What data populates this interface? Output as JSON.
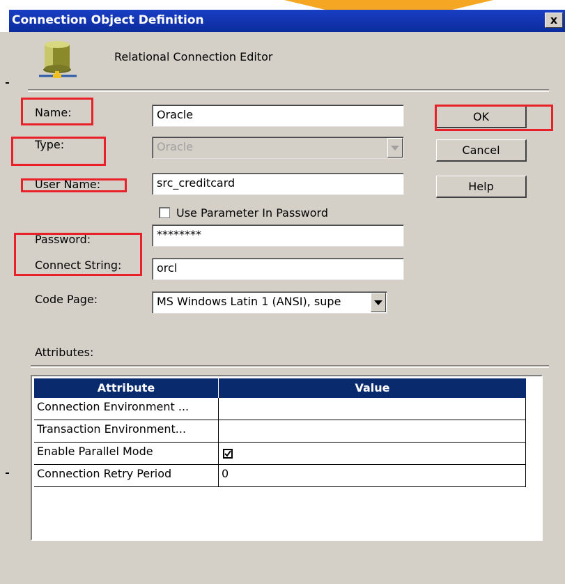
{
  "window": {
    "title": "Connection Object Definition",
    "close_glyph": "x",
    "subtitle": "Relational Connection Editor",
    "icon": "database-icon"
  },
  "form": {
    "name_label": "Name:",
    "name_value": "Oracle",
    "type_label": "Type:",
    "type_value": "Oracle",
    "username_label": "User Name:",
    "username_value": "src_creditcard",
    "use_param_label": "Use Parameter In Password",
    "use_param_checked": false,
    "password_label": "Password:",
    "password_value": "********",
    "connect_label": "Connect String:",
    "connect_value": "orcl",
    "codepage_label": "Code Page:",
    "codepage_value": "MS Windows Latin 1 (ANSI), supe"
  },
  "buttons": {
    "ok": "OK",
    "cancel": "Cancel",
    "help": "Help"
  },
  "attributes": {
    "section_label": "Attributes:",
    "columns": [
      "Attribute",
      "Value"
    ],
    "rows": [
      {
        "attribute": "Connection Environment ...",
        "value": ""
      },
      {
        "attribute": "Transaction Environment...",
        "value": ""
      },
      {
        "attribute": "Enable Parallel Mode",
        "value": "",
        "checked": true
      },
      {
        "attribute": "Connection Retry Period",
        "value": "0"
      }
    ]
  },
  "colors": {
    "titlebar": "#0b2a9c",
    "highlight_box": "#e8202a",
    "grid_header": "#0a2a6e",
    "dialog_bg": "#d4d0c8"
  }
}
